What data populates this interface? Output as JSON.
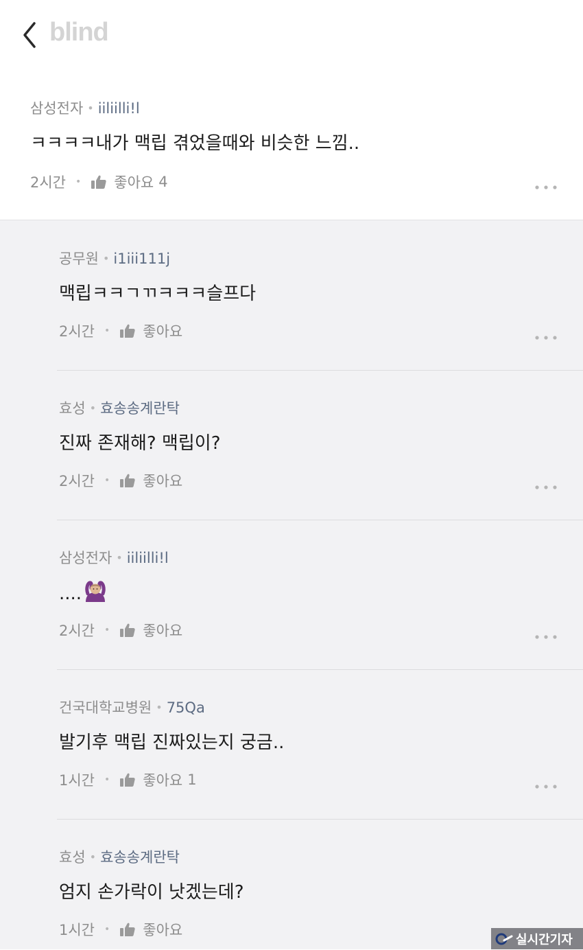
{
  "app": {
    "logo": "blind"
  },
  "top_comment": {
    "company": "삼성전자",
    "nickname": "iiliilli!l",
    "text": "ㅋㅋㅋㅋ내가 맥립 겪었을때와 비슷한 느낌..",
    "time": "2시간",
    "like_label": "좋아요",
    "like_count": "4"
  },
  "replies": [
    {
      "company": "공무원",
      "nickname": "i1iii111j",
      "text": "맥립ㅋㅋㄱㄲㅋㅋㅋ슬프다",
      "time": "2시간",
      "like_label": "좋아요",
      "like_count": ""
    },
    {
      "company": "효성",
      "nickname": "효송송계란탁",
      "text": "진짜 존재해? 맥립이?",
      "time": "2시간",
      "like_label": "좋아요",
      "like_count": ""
    },
    {
      "company": "삼성전자",
      "nickname": "iiliilli!l",
      "text": "....",
      "emoji": "person-gesturing-ok",
      "time": "2시간",
      "like_label": "좋아요",
      "like_count": ""
    },
    {
      "company": "건국대학교병원",
      "nickname": "75Qa",
      "text": "발기후 맥립 진짜있는지 궁금..",
      "time": "1시간",
      "like_label": "좋아요",
      "like_count": "1"
    },
    {
      "company": "효성",
      "nickname": "효송송계란탁",
      "text": "엄지 손가락이 낫겠는데?",
      "time": "1시간",
      "like_label": "좋아요",
      "like_count": ""
    }
  ],
  "watermark": {
    "text": "실시간기자"
  },
  "icons": {
    "back": "chevron-left-icon",
    "like": "thumbs-up-icon",
    "more": "more-horizontal-icon"
  },
  "colors": {
    "logo": "#d4d4d4",
    "nickname": "#5c6b82",
    "meta": "#8d8d8d",
    "reply_background": "#f2f2f4"
  }
}
